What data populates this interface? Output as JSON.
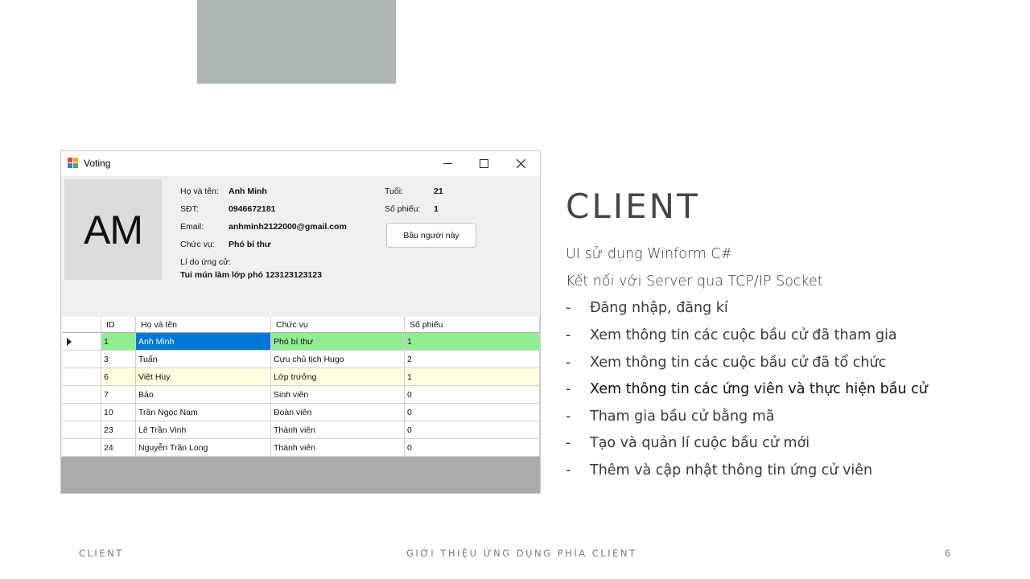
{
  "window": {
    "title": "Voting",
    "avatar_initials": "AM",
    "profile": {
      "name_label": "Họ và tên:",
      "name": "Anh Minh",
      "phone_label": "SĐT:",
      "phone": "0946672181",
      "email_label": "Email:",
      "email": "anhminh2122000@gmail.com",
      "position_label": "Chức vụ:",
      "position": "Phó bí thư",
      "reason_label": "Lí do ứng cử:",
      "reason": "Tui mún làm lớp phó 123123123123",
      "age_label": "Tuổi:",
      "age": "21",
      "votes_label": "Số phiếu:",
      "votes": "1"
    },
    "vote_button": "Bầu người này",
    "table": {
      "columns": [
        "ID",
        "Họ và tên",
        "Chức vụ",
        "Số phiếu"
      ],
      "rows": [
        {
          "id": "1",
          "name": "Anh Minh",
          "role": "Phó bí thư",
          "votes": "1"
        },
        {
          "id": "3",
          "name": "Tuấn",
          "role": "Cựu chủ tịch Hugo",
          "votes": "2"
        },
        {
          "id": "6",
          "name": "Việt Huy",
          "role": "Lớp trưởng",
          "votes": "1"
        },
        {
          "id": "7",
          "name": "Bảo",
          "role": "Sinh viên",
          "votes": "0"
        },
        {
          "id": "10",
          "name": "Trần Ngọc Nam",
          "role": "Đoàn viên",
          "votes": "0"
        },
        {
          "id": "23",
          "name": "Lê Trần Vinh",
          "role": "Thành viên",
          "votes": "0"
        },
        {
          "id": "24",
          "name": "Nguyễn Trần Long",
          "role": "Thành viên",
          "votes": "0"
        }
      ]
    },
    "colors": {
      "selected": "#0078d7",
      "winner_row": "#90ee90",
      "alt_row": "#ffffe0"
    }
  },
  "slide": {
    "title": "CLIENT",
    "lines": [
      "UI sử dụng Winform C#",
      "Kết nối với Server qua TCP/IP Socket"
    ],
    "bullets": [
      "Đăng nhập, đăng kí",
      "Xem thông tin các cuộc bầu cử đã tham gia",
      "Xem thông tin các cuộc bầu cử đã tổ chức",
      "Xem thông tin các ứng viên và thực hiện bầu cử",
      "Tham gia bầu cử bằng mã",
      "Tạo và quản lí cuộc bầu cử mới",
      "Thêm và cập nhật thông tin ứng cử viên"
    ],
    "bullet_marker": "-"
  },
  "footer": {
    "left": "CLIENT",
    "center": "GIỚI THIỆU ỨNG DỤNG PHÍA CLIENT",
    "page": "6"
  }
}
